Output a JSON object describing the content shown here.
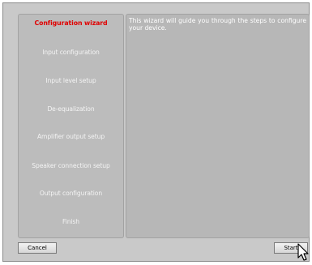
{
  "wizard": {
    "steps": [
      {
        "label": "Configuration wizard",
        "active": true
      },
      {
        "label": "Input configuration",
        "active": false
      },
      {
        "label": "Input level setup",
        "active": false
      },
      {
        "label": "De-equalization",
        "active": false
      },
      {
        "label": "Amplifier output setup",
        "active": false
      },
      {
        "label": "Speaker connection setup",
        "active": false
      },
      {
        "label": "Output configuration",
        "active": false
      },
      {
        "label": "Finish",
        "active": false
      }
    ],
    "description": "This wizard will guide you through the steps to configure your device."
  },
  "buttons": {
    "cancel": "Cancel",
    "start": "Start"
  },
  "colors": {
    "active_step": "#e00000",
    "inactive_step": "#f4f4f4",
    "panel_bg": "#bcbcbc",
    "window_bg": "#c9c9c9"
  },
  "icons": {
    "cursor": "mouse-pointer-icon"
  }
}
